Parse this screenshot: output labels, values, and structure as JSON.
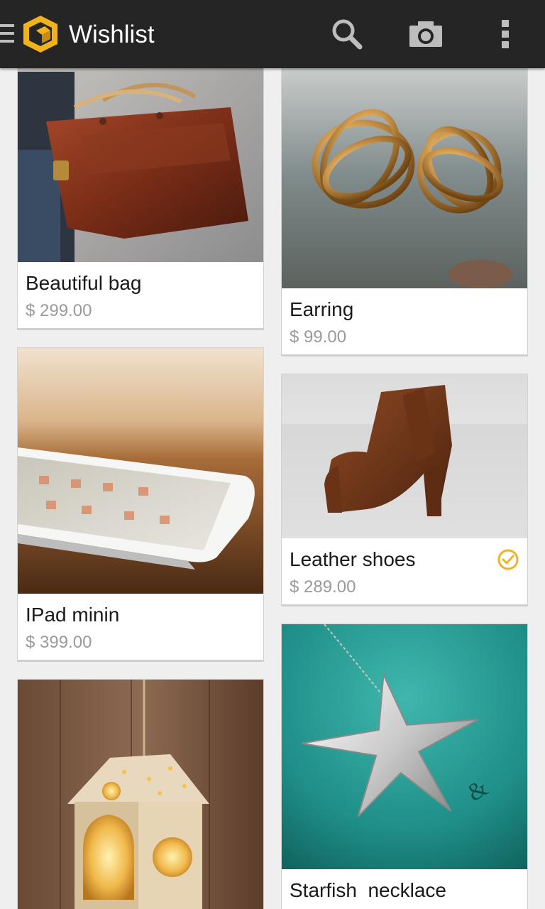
{
  "app": {
    "title": "Wishlist"
  },
  "actions": {
    "up_icon": "menu-icon",
    "search_icon": "search-icon",
    "camera_icon": "camera-icon",
    "overflow_icon": "overflow-menu-icon"
  },
  "colors": {
    "appbar": "#252525",
    "accent": "#f2b21b",
    "check": "#f0b22a",
    "price": "#9a9a9a"
  },
  "items": [
    {
      "name": "Beautiful bag",
      "price": "$ 299.00",
      "purchased": false
    },
    {
      "name": "Earring",
      "price": "$ 99.00",
      "purchased": false
    },
    {
      "name": "IPad minin",
      "price": "$ 399.00",
      "purchased": false
    },
    {
      "name": "Leather shoes",
      "price": "$ 289.00",
      "purchased": true
    },
    {
      "name": "Starfish  necklace",
      "price": "",
      "purchased": false
    },
    {
      "name": "",
      "price": "",
      "purchased": false
    }
  ]
}
